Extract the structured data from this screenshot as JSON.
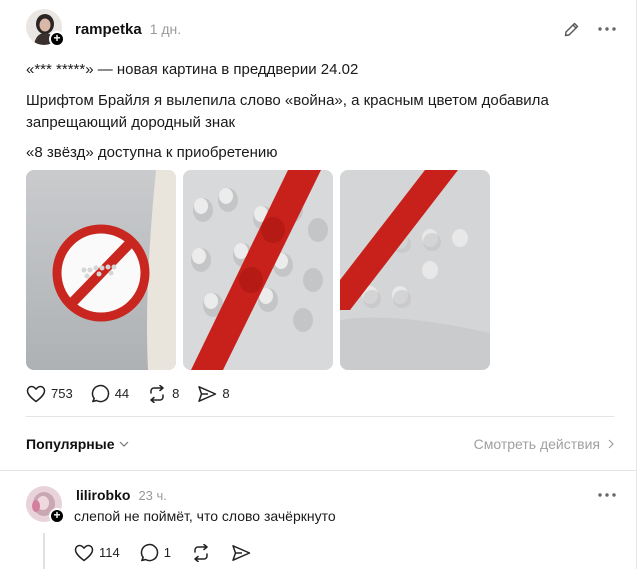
{
  "post": {
    "username": "rampetka",
    "time": "1 дн.",
    "line1": "«*** *****» — новая картина в преддверии 24.02",
    "line2": "Шрифтом Брайля я вылепила слово «война», а красным цветом добавила запрещающий дородный знак",
    "line3": "«8 звёзд» доступна к приобретению",
    "stats": {
      "likes": "753",
      "replies": "44",
      "reposts": "8",
      "shares": "8"
    }
  },
  "comments_bar": {
    "sort_label": "Популярные",
    "view_actions_label": "Смотреть действия"
  },
  "comment": {
    "username": "lilirobko",
    "time": "23 ч.",
    "text": "слепой не поймёт, что слово зачёркнуто",
    "stats": {
      "likes": "114",
      "replies": "1"
    }
  },
  "colors": {
    "accent_red": "#d0201a",
    "muted": "#9a9a9a"
  },
  "icons": [
    "edit-icon",
    "more-icon",
    "heart-icon",
    "reply-icon",
    "repost-icon",
    "share-icon",
    "chevron-down-icon",
    "chevron-right-icon",
    "follow-plus-icon"
  ]
}
